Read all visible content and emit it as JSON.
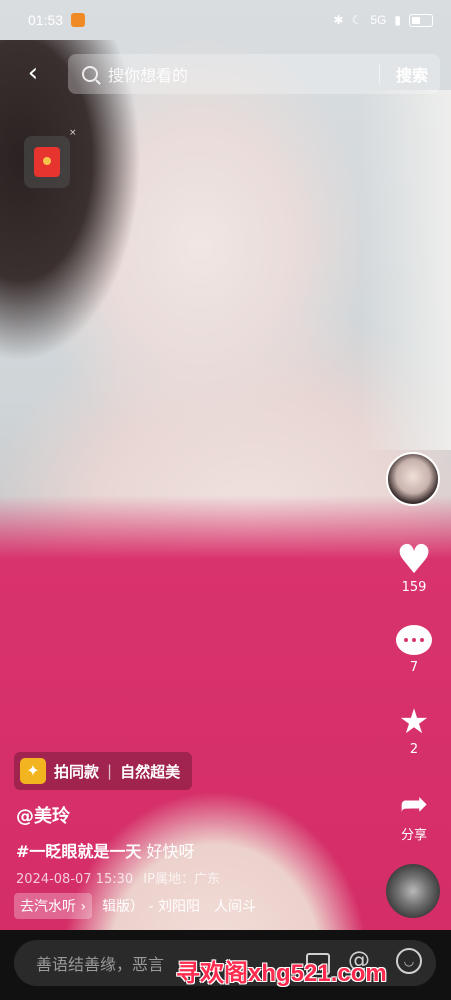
{
  "status_bar": {
    "time": "01:53",
    "network": "5G"
  },
  "top_bar": {
    "search_placeholder": "搜你想看的",
    "search_button": "搜索"
  },
  "side_actions": {
    "like_count": "159",
    "comment_count": "7",
    "favorite_count": "2",
    "share_label": "分享"
  },
  "video_info": {
    "template_button": "拍同款",
    "template_name": "自然超美",
    "author": "@美玲",
    "caption_hashtag": "#一眨眼就是一天",
    "caption_text": "好快呀",
    "date": "2024-08-07 15:30",
    "ip_location": "IP属地：广东",
    "music_chip": "去汽水听 ›",
    "music_title": "辑版） - 刘阳阳　人间斗"
  },
  "comment_bar": {
    "placeholder": "善语结善缘，恶言"
  },
  "watermark": "寻欢阁xhg521.com"
}
